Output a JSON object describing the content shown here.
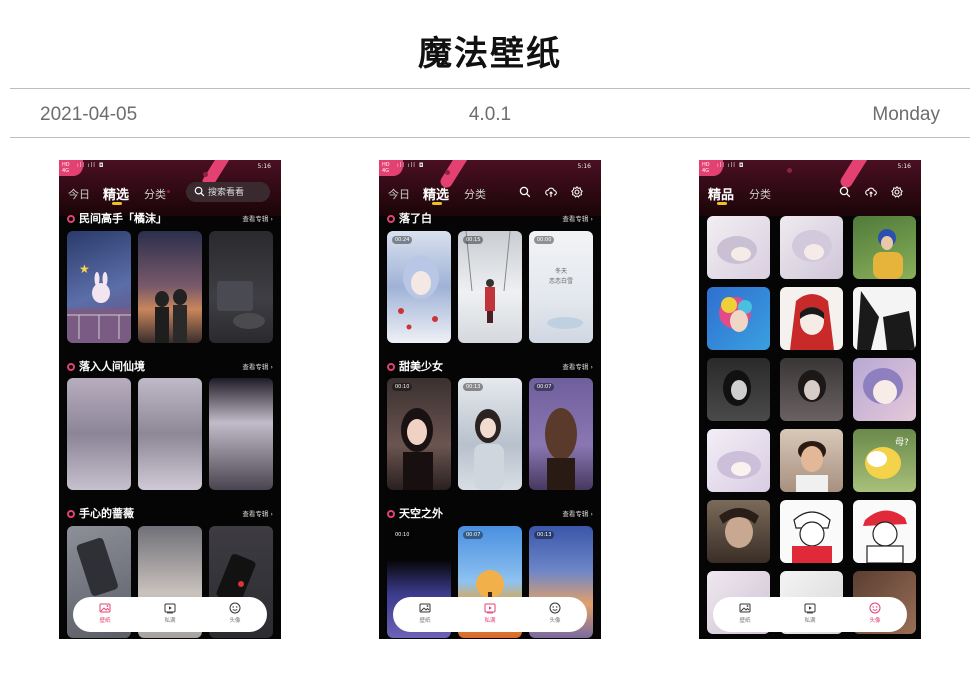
{
  "header": {
    "title": "魔法壁纸",
    "date": "2021-04-05",
    "version": "4.0.1",
    "weekday": "Monday"
  },
  "status_bar": {
    "time": "5:16"
  },
  "colors": {
    "accent": "#e24172",
    "indicator": "#f0c020",
    "background": "#050505"
  },
  "nav": {
    "items": [
      {
        "label": "壁纸",
        "icon": "image-icon"
      },
      {
        "label": "私满",
        "icon": "video-icon"
      },
      {
        "label": "头像",
        "icon": "smile-icon"
      }
    ]
  },
  "screen1": {
    "tabs": [
      "今日",
      "精选",
      "分类"
    ],
    "search_placeholder": "搜索看看",
    "sections": [
      {
        "title": "民间高手「橘沫」",
        "more": "查看专辑 ›"
      },
      {
        "title": "落入人间仙境",
        "more": "查看专辑 ›"
      },
      {
        "title": "手心的蔷薇",
        "more": "查看专辑 ›"
      }
    ]
  },
  "screen2": {
    "tabs": [
      "今日",
      "精选",
      "分类"
    ],
    "sections": [
      {
        "title": "落了白",
        "more": "查看专辑 ›",
        "times": [
          "00:24",
          "00:15",
          "00:00"
        ]
      },
      {
        "title": "甜美少女",
        "more": "查看专辑 ›",
        "times": [
          "00:10",
          "00:13",
          "00:07"
        ]
      },
      {
        "title": "天空之外",
        "more": "查看专辑 ›",
        "times": [
          "00:10",
          "00:07",
          "00:13"
        ]
      }
    ]
  },
  "screen3": {
    "tabs": [
      "精品",
      "分类"
    ]
  }
}
